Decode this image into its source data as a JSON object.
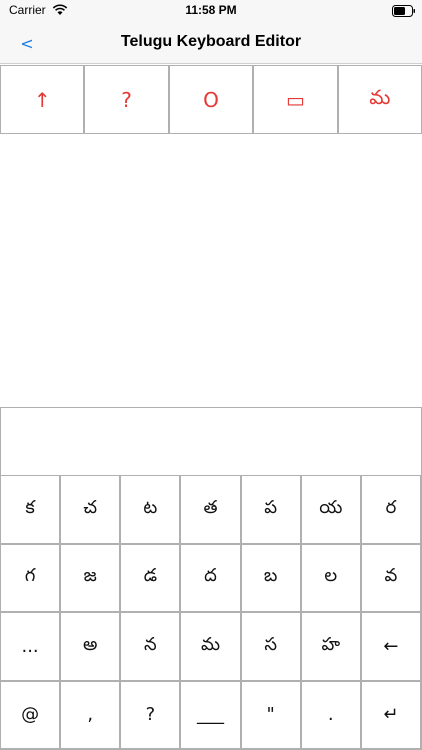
{
  "status_bar": {
    "carrier": "Carrier",
    "time": "11:58 PM"
  },
  "nav": {
    "back_label": "<",
    "title": "Telugu Keyboard Editor"
  },
  "top_row": [
    "↑",
    "?",
    "O",
    "▭",
    "మ"
  ],
  "keyboard_rows": [
    [
      "క",
      "చ",
      "ట",
      "త",
      "ప",
      "య",
      "ర"
    ],
    [
      "గ",
      "జ",
      "డ",
      "ద",
      "బ",
      "ల",
      "వ"
    ],
    [
      "...",
      "అ",
      "న",
      "మ",
      "స",
      "హ",
      "←"
    ],
    [
      "@",
      ",",
      "?",
      "___",
      "\"",
      ".",
      "↵"
    ]
  ],
  "colors": {
    "accent_red": "#e53935",
    "back_blue": "#1a7de0",
    "border": "#b0b0b0"
  }
}
